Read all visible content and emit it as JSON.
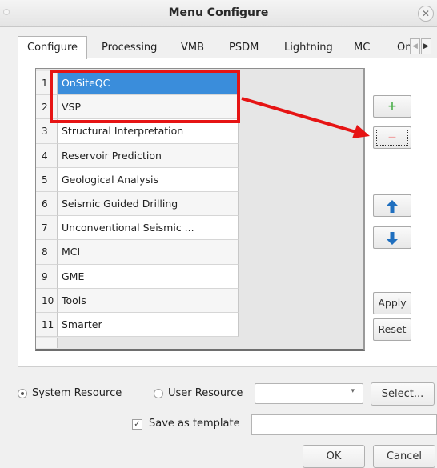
{
  "window": {
    "title": "Menu Configure",
    "close_glyph": "✕"
  },
  "tabs": [
    {
      "label": "Configure",
      "active": true
    },
    {
      "label": "Processing"
    },
    {
      "label": "VMB"
    },
    {
      "label": "PSDM"
    },
    {
      "label": "Lightning"
    },
    {
      "label": "MC"
    },
    {
      "label": "On"
    }
  ],
  "tab_scroll": {
    "left": "◀",
    "right": "▶"
  },
  "menu_list": [
    {
      "num": "1",
      "name": "OnSiteQC",
      "selected": true
    },
    {
      "num": "2",
      "name": "VSP"
    },
    {
      "num": "3",
      "name": "Structural Interpretation"
    },
    {
      "num": "4",
      "name": "Reservoir  Prediction"
    },
    {
      "num": "5",
      "name": "Geological Analysis"
    },
    {
      "num": "6",
      "name": "Seismic Guided Drilling"
    },
    {
      "num": "7",
      "name": "Unconventional Seismic ..."
    },
    {
      "num": "8",
      "name": "MCI"
    },
    {
      "num": "9",
      "name": "GME"
    },
    {
      "num": "10",
      "name": "Tools"
    },
    {
      "num": "11",
      "name": "Smarter"
    }
  ],
  "side_buttons": {
    "add_glyph": "+",
    "remove_glyph": "−",
    "up_icon": "arrow-up-icon",
    "down_icon": "arrow-down-icon",
    "apply_label": "Apply",
    "reset_label": "Reset"
  },
  "annotation": {
    "highlight_color": "#e61414"
  },
  "resource": {
    "system_label": "System Resource",
    "system_checked": true,
    "user_label": "User Resource",
    "combo_value": "",
    "select_label": "Select..."
  },
  "template": {
    "checkbox_label": "Save as template",
    "checked": true,
    "checkmark": "✓",
    "name_value": ""
  },
  "dialog_buttons": {
    "ok_label": "OK",
    "cancel_label": "Cancel"
  },
  "colors": {
    "selection": "#3a8ddb",
    "add_icon": "#4fb04f",
    "arrow_icon": "#1f6fbf"
  }
}
